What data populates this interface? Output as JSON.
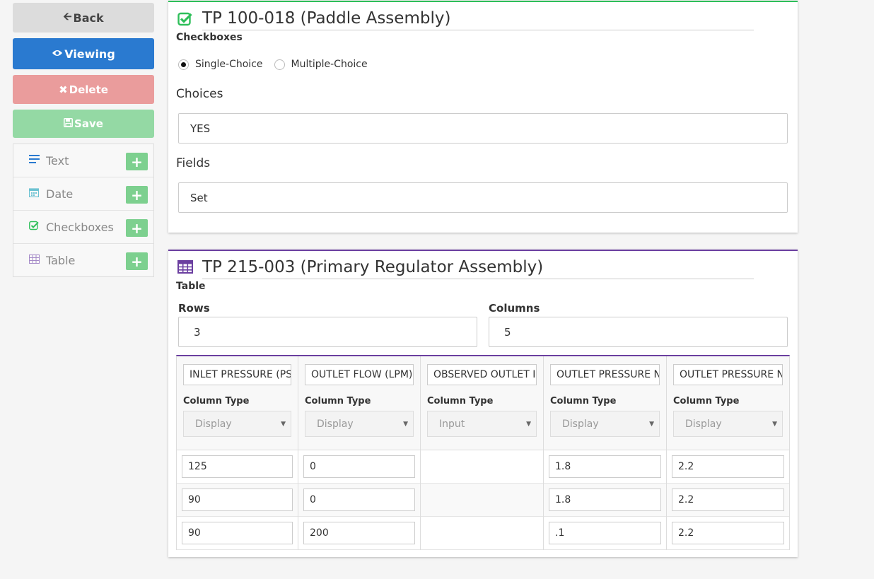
{
  "sidebar": {
    "back_label": "Back",
    "viewing_label": "Viewing",
    "delete_label": "Delete",
    "save_label": "Save",
    "palette": [
      {
        "label": "Text",
        "icon": "lines-icon"
      },
      {
        "label": "Date",
        "icon": "calendar-icon"
      },
      {
        "label": "Checkboxes",
        "icon": "check-square-icon"
      },
      {
        "label": "Table",
        "icon": "table-icon"
      }
    ]
  },
  "checkbox_card": {
    "title": "TP 100-018 (Paddle Assembly)",
    "kind": "Checkboxes",
    "single_choice_label": "Single-Choice",
    "multiple_choice_label": "Multiple-Choice",
    "selected": "Single-Choice",
    "choices_label": "Choices",
    "choices_value": "YES",
    "fields_label": "Fields",
    "fields_value": "Set",
    "accent_color": "#2fbf5a"
  },
  "table_card": {
    "title": "TP 215-003 (Primary Regulator Assembly)",
    "kind": "Table",
    "rows_label": "Rows",
    "rows_value": "3",
    "columns_label": "Columns",
    "columns_value": "5",
    "accent_color": "#6b3fa0",
    "column_type_label": "Column Type",
    "columns": [
      {
        "header": "INLET PRESSURE (PS",
        "type": "Display",
        "cells": [
          "125",
          "90",
          "90"
        ]
      },
      {
        "header": "OUTLET FLOW (LPM)",
        "type": "Display",
        "cells": [
          "0",
          "0",
          "200"
        ]
      },
      {
        "header": "OBSERVED OUTLET I",
        "type": "Input",
        "cells": [
          "",
          "",
          ""
        ]
      },
      {
        "header": "OUTLET PRESSURE N",
        "type": "Display",
        "cells": [
          "1.8",
          "1.8",
          ".1"
        ]
      },
      {
        "header": "OUTLET PRESSURE N",
        "type": "Display",
        "cells": [
          "2.2",
          "2.2",
          "2.2"
        ]
      }
    ]
  }
}
